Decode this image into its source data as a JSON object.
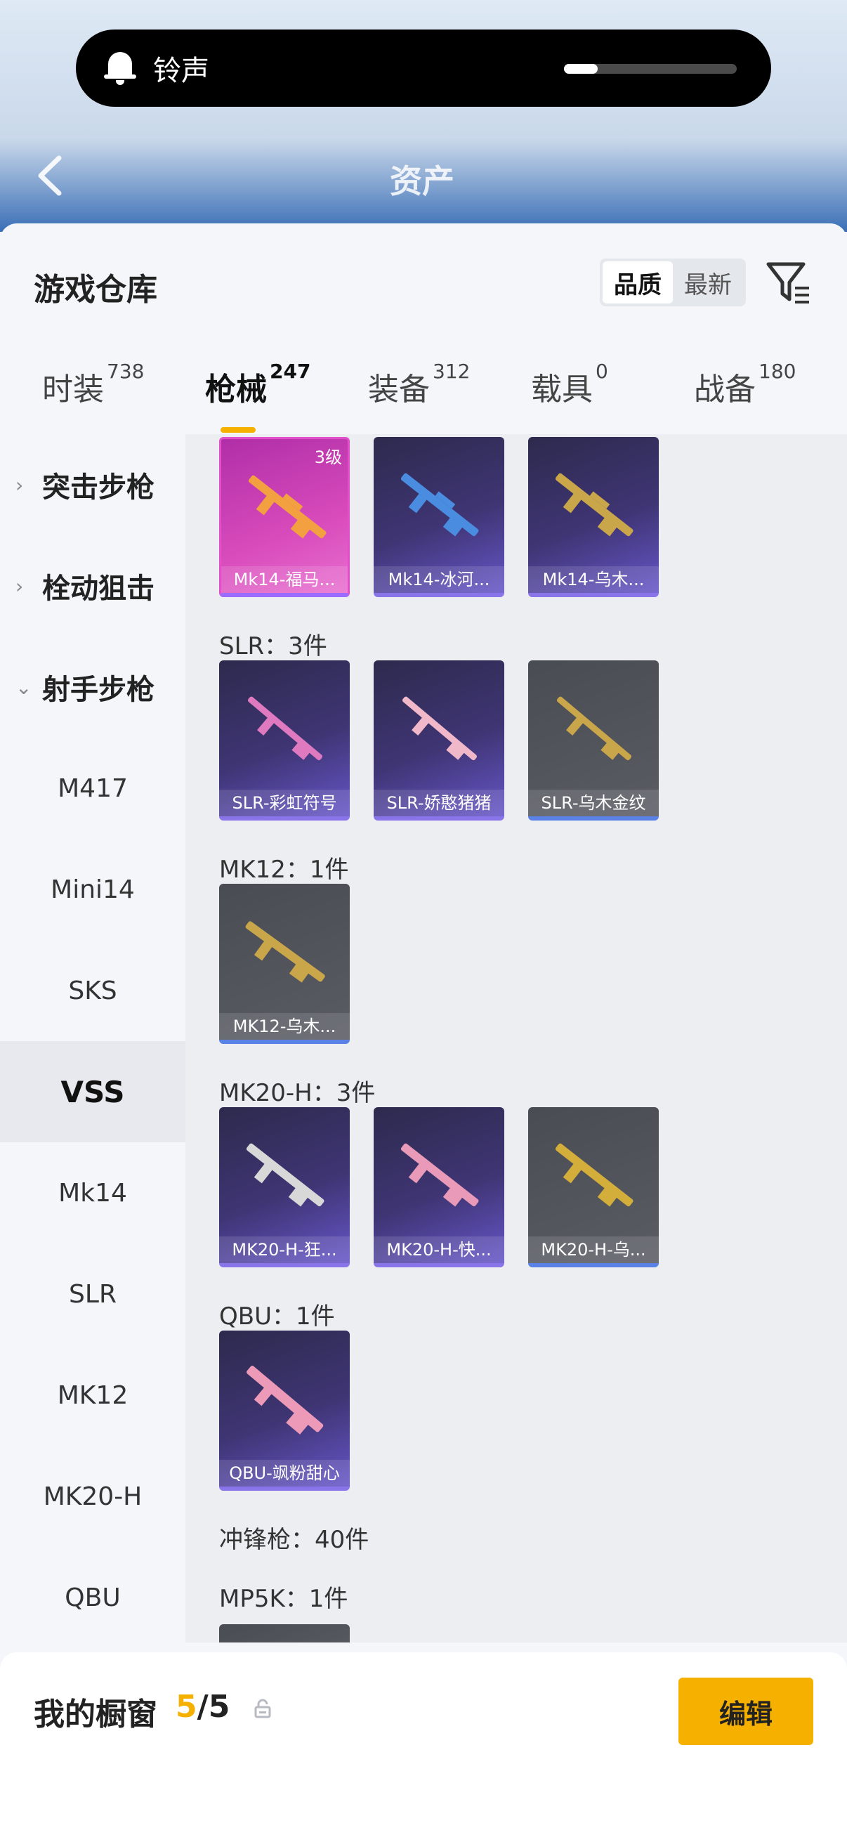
{
  "header": {
    "title": "资产"
  },
  "notification": {
    "label": "铃声",
    "volume_fraction": 0.2
  },
  "sheet": {
    "title": "游戏仓库",
    "sort": {
      "options": [
        "品质",
        "最新"
      ],
      "selected": "品质"
    }
  },
  "tabs": [
    {
      "label": "时装",
      "count": "738"
    },
    {
      "label": "枪械",
      "count": "247",
      "active": true
    },
    {
      "label": "装备",
      "count": "312"
    },
    {
      "label": "载具",
      "count": "0"
    },
    {
      "label": "战备",
      "count": "180"
    }
  ],
  "side_menu": [
    {
      "label": "突击步枪",
      "type": "group",
      "expanded": false
    },
    {
      "label": "栓动狙击",
      "type": "group",
      "expanded": false
    },
    {
      "label": "射手步枪",
      "type": "group",
      "expanded": true
    },
    {
      "label": "M417"
    },
    {
      "label": "Mini14"
    },
    {
      "label": "SKS"
    },
    {
      "label": "VSS",
      "selected": true
    },
    {
      "label": "Mk14"
    },
    {
      "label": "SLR"
    },
    {
      "label": "MK12"
    },
    {
      "label": "MK20-H"
    },
    {
      "label": "QBU"
    }
  ],
  "sections": [
    {
      "label": "SLR：3件"
    },
    {
      "label": "MK12：1件"
    },
    {
      "label": "MK20-H：3件"
    },
    {
      "label": "QBU：1件"
    },
    {
      "label": "冲锋枪：40件"
    },
    {
      "label": "MP5K：1件"
    }
  ],
  "items": [
    {
      "name": "Mk14-福马...",
      "level": "3级",
      "rarity": "pink",
      "gun_color": "#f2a040"
    },
    {
      "name": "Mk14-冰河...",
      "rarity": "purple",
      "gun_color": "#4a8de0"
    },
    {
      "name": "Mk14-乌木...",
      "rarity": "purple",
      "gun_color": "#c9a64a"
    },
    {
      "name": "SLR-彩虹符号",
      "rarity": "purple",
      "gun_color": "#e07ac0"
    },
    {
      "name": "SLR-娇憨猪猪",
      "rarity": "purple",
      "gun_color": "#f0b8c8"
    },
    {
      "name": "SLR-乌木金纹",
      "rarity": "grey",
      "gun_color": "#c9a64a"
    },
    {
      "name": "MK12-乌木...",
      "rarity": "grey",
      "gun_color": "#c9a64a"
    },
    {
      "name": "MK20-H-狂...",
      "rarity": "purple",
      "gun_color": "#d8d8d8"
    },
    {
      "name": "MK20-H-快...",
      "rarity": "purple",
      "gun_color": "#e89ab8"
    },
    {
      "name": "MK20-H-乌...",
      "rarity": "grey",
      "gun_color": "#d4ae3a"
    },
    {
      "name": "QBU-飒粉甜心",
      "rarity": "purple",
      "gun_color": "#ec9ab8"
    }
  ],
  "showcase": {
    "label": "我的橱窗",
    "current": "5",
    "sep": "/",
    "max": "5",
    "edit_label": "编辑"
  },
  "colors": {
    "accent": "#f6b100",
    "pill_bg": "#000000"
  },
  "icons": [
    "bell-icon",
    "back-arrow-icon",
    "filter-icon",
    "chevron-right-icon",
    "chevron-down-icon",
    "share-icon",
    "lock-icon"
  ]
}
